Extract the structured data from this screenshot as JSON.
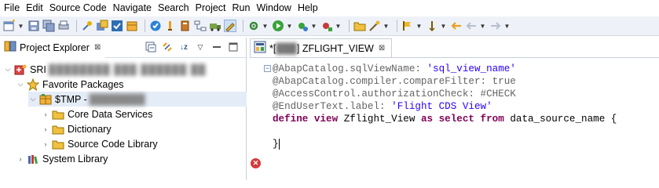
{
  "menu": [
    "File",
    "Edit",
    "Source Code",
    "Navigate",
    "Search",
    "Project",
    "Run",
    "Window",
    "Help"
  ],
  "toolbar_icons": [
    "new-icon",
    "save-icon",
    "save-all-icon",
    "print-icon",
    "connect-icon",
    "open-object-icon",
    "activate-icon",
    "check-icon",
    "new-package-icon",
    "run-icon",
    "debug-icon",
    "external-tools-icon",
    "open-type-icon",
    "search-icon",
    "annotation-nav-icon",
    "back-icon",
    "forward-icon"
  ],
  "project_explorer": {
    "tab_label": "Project Explorer",
    "close_glyph": "⊠",
    "tree": {
      "project": "SRI",
      "favorite_packages": "Favorite Packages",
      "tmp_package": "$TMP -",
      "folders": [
        "Core Data Services",
        "Dictionary",
        "Source Code Library"
      ],
      "system_library": "System Library"
    }
  },
  "editor": {
    "tab_prefix": "*[",
    "tab_title": "] ZFLIGHT_VIEW",
    "tab_close_glyph": "⊠",
    "code": {
      "line1": "@AbapCatalog.sqlViewName: ",
      "line1_str": "'sql_view_name'",
      "line2": "@AbapCatalog.compiler.compareFilter: true",
      "line3": "@AccessControl.authorizationCheck: #CHECK",
      "line4": "@EndUserText.label: ",
      "line4_str": "'Flight CDS View'",
      "line5_kw1": "define view ",
      "line5_name": "Zflight_View ",
      "line5_kw2": "as select from ",
      "line5_rest": "data_source_name {",
      "line7": "}"
    }
  },
  "colors": {
    "annotation": "#646464",
    "keyword": "#7f0055",
    "string": "#2a00ff",
    "error": "#d33b3b"
  }
}
